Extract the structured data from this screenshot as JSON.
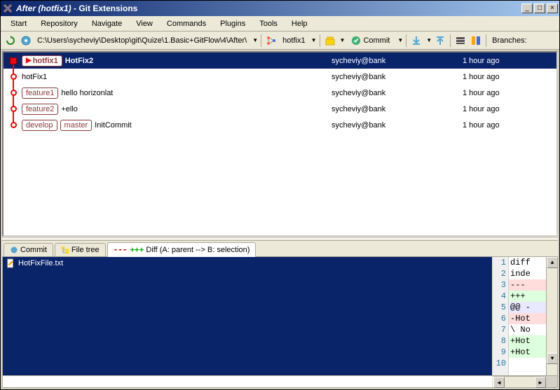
{
  "window": {
    "title_prefix": "After (hotfix1)",
    "title_suffix": " - Git Extensions"
  },
  "menu": [
    "Start",
    "Repository",
    "Navigate",
    "View",
    "Commands",
    "Plugins",
    "Tools",
    "Help"
  ],
  "toolbar": {
    "path": "C:\\Users\\sycheviy\\Desktop\\git\\Quize\\1.Basic+GitFlow\\4\\After\\",
    "branch": "hotfix1",
    "commit_label": "Commit",
    "branches_label": "Branches:"
  },
  "commits": [
    {
      "refs": [
        {
          "name": "hotfix1",
          "current": true
        }
      ],
      "msg": "HotFix2",
      "author": "sycheviy@bank",
      "date": "1 hour ago",
      "selected": true,
      "graph": "square"
    },
    {
      "refs": [],
      "msg": "hotFix1",
      "author": "sycheviy@bank",
      "date": "1 hour ago",
      "graph": "dot"
    },
    {
      "refs": [
        {
          "name": "feature1"
        }
      ],
      "msg": "hello horizonlat",
      "author": "sycheviy@bank",
      "date": "1 hour ago",
      "graph": "dot"
    },
    {
      "refs": [
        {
          "name": "feature2"
        }
      ],
      "msg": "+ello",
      "author": "sycheviy@bank",
      "date": "1 hour ago",
      "graph": "dot"
    },
    {
      "refs": [
        {
          "name": "develop"
        },
        {
          "name": "master"
        }
      ],
      "msg": "InitCommit",
      "author": "sycheviy@bank",
      "date": "1 hour ago",
      "graph": "dot"
    }
  ],
  "tabs": {
    "commit": "Commit",
    "filetree": "File tree",
    "diff": "Diff (A: parent --> B: selection)"
  },
  "file": {
    "name": "HotFixFile.txt"
  },
  "diff": {
    "lines": [
      {
        "n": 1,
        "t": "diff",
        "cls": ""
      },
      {
        "n": 2,
        "t": "inde",
        "cls": ""
      },
      {
        "n": 3,
        "t": "--- ",
        "cls": "del"
      },
      {
        "n": 4,
        "t": "+++ ",
        "cls": "add"
      },
      {
        "n": 5,
        "t": "@@ -",
        "cls": "hunk"
      },
      {
        "n": 6,
        "t": "-Hot",
        "cls": "del"
      },
      {
        "n": 7,
        "t": "\\ No",
        "cls": ""
      },
      {
        "n": 8,
        "t": "+Hot",
        "cls": "add"
      },
      {
        "n": 9,
        "t": "+Hot",
        "cls": "add"
      },
      {
        "n": 10,
        "t": "",
        "cls": ""
      }
    ]
  }
}
